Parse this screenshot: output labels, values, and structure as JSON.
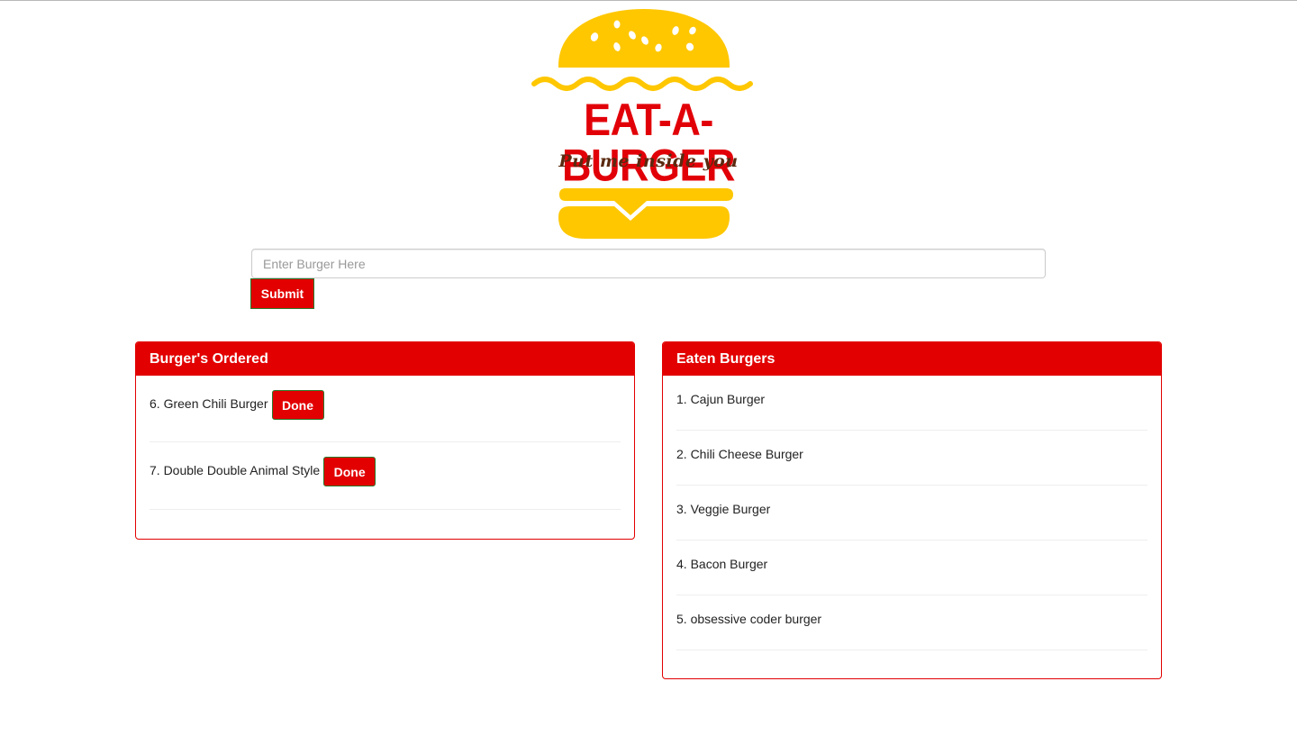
{
  "logo": {
    "title": "EAT-A-BURGER",
    "tagline": "Put me inside you",
    "colors": {
      "bun": "#ffc700",
      "title": "#e20008",
      "tagline": "#5a2a10"
    }
  },
  "form": {
    "placeholder": "Enter Burger Here",
    "value": "",
    "submit_label": "Submit"
  },
  "ordered": {
    "heading": "Burger's Ordered",
    "items": [
      {
        "label": "6. Green Chili Burger",
        "button": "Done"
      },
      {
        "label": "7. Double Double Animal Style",
        "button": "Done"
      }
    ]
  },
  "eaten": {
    "heading": "Eaten Burgers",
    "items": [
      {
        "label": "1. Cajun Burger"
      },
      {
        "label": "2. Chili Cheese Burger"
      },
      {
        "label": "3. Veggie Burger"
      },
      {
        "label": "4. Bacon Burger"
      },
      {
        "label": "5. obsessive coder burger"
      }
    ]
  },
  "theme": {
    "accent": "#e20000",
    "button_border": "#2c7a2c"
  }
}
